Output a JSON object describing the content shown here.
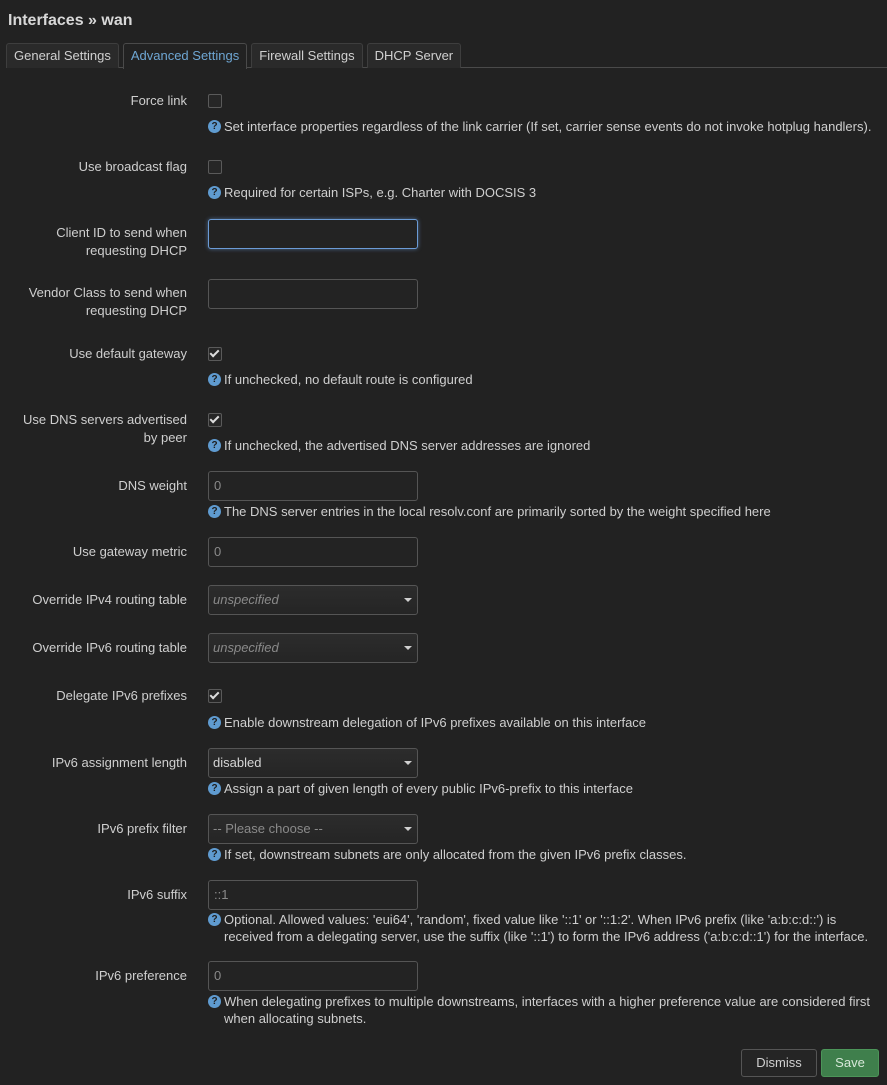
{
  "header": {
    "title": "Interfaces » wan"
  },
  "tabs": [
    {
      "label": "General Settings",
      "active": false
    },
    {
      "label": "Advanced Settings",
      "active": true
    },
    {
      "label": "Firewall Settings",
      "active": false
    },
    {
      "label": "DHCP Server",
      "active": false
    }
  ],
  "fields": {
    "force_link": {
      "label": "Force link",
      "checked": false,
      "help": "Set interface properties regardless of the link carrier (If set, carrier sense events do not invoke hotplug handlers)."
    },
    "broadcast_flag": {
      "label": "Use broadcast flag",
      "checked": false,
      "help": "Required for certain ISPs, e.g. Charter with DOCSIS 3"
    },
    "client_id": {
      "label_line1": "Client ID to send when",
      "label_line2": "requesting DHCP",
      "value": ""
    },
    "vendor_class": {
      "label_line1": "Vendor Class to send when",
      "label_line2": "requesting DHCP",
      "value": ""
    },
    "default_gateway": {
      "label": "Use default gateway",
      "checked": true,
      "help": "If unchecked, no default route is configured"
    },
    "peer_dns": {
      "label_line1": "Use DNS servers advertised",
      "label_line2": "by peer",
      "checked": true,
      "help": "If unchecked, the advertised DNS server addresses are ignored"
    },
    "dns_weight": {
      "label": "DNS weight",
      "placeholder": "0",
      "help": "The DNS server entries in the local resolv.conf are primarily sorted by the weight specified here"
    },
    "gateway_metric": {
      "label": "Use gateway metric",
      "placeholder": "0"
    },
    "ipv4_table": {
      "label": "Override IPv4 routing table",
      "selected": "unspecified"
    },
    "ipv6_table": {
      "label": "Override IPv6 routing table",
      "selected": "unspecified"
    },
    "delegate": {
      "label": "Delegate IPv6 prefixes",
      "checked": true,
      "help": "Enable downstream delegation of IPv6 prefixes available on this interface"
    },
    "ip6assign": {
      "label": "IPv6 assignment length",
      "selected": "disabled",
      "help": "Assign a part of given length of every public IPv6-prefix to this interface"
    },
    "ip6class": {
      "label": "IPv6 prefix filter",
      "selected": "-- Please choose --",
      "help": "If set, downstream subnets are only allocated from the given IPv6 prefix classes."
    },
    "ip6ifaceid": {
      "label": "IPv6 suffix",
      "placeholder": "::1",
      "help_line1": "Optional. Allowed values: 'eui64', 'random', fixed value like '::1' or '::1:2'. When IPv6 prefix (like 'a:b:c:d::') is",
      "help_line2": "received from a delegating server, use the suffix (like '::1') to form the IPv6 address ('a:b:c:d::1') for the interface."
    },
    "ip6weight": {
      "label": "IPv6 preference",
      "placeholder": "0",
      "help_line1": "When delegating prefixes to multiple downstreams, interfaces with a higher preference value are considered first",
      "help_line2": "when allocating subnets."
    }
  },
  "buttons": {
    "dismiss": "Dismiss",
    "save": "Save"
  },
  "icons": {
    "help": "?"
  },
  "colors": {
    "accent": "#6ea6d3",
    "save": "#3f7f4c",
    "help_icon": "#5f9bd0",
    "background": "#222222"
  }
}
